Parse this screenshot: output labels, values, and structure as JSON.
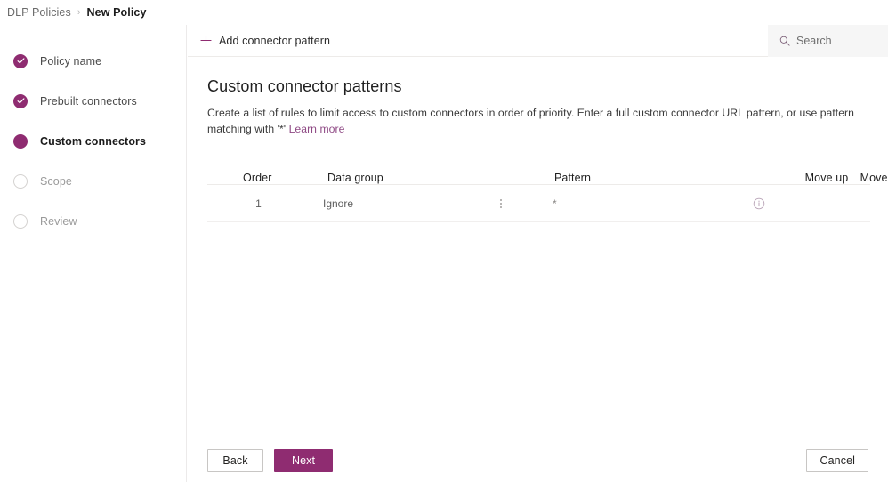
{
  "breadcrumb": {
    "parent": "DLP Policies",
    "separator": "›",
    "current": "New Policy"
  },
  "wizard": {
    "steps": [
      {
        "label": "Policy name",
        "state": "done",
        "icon": "check-icon"
      },
      {
        "label": "Prebuilt connectors",
        "state": "done",
        "icon": "check-icon"
      },
      {
        "label": "Custom connectors",
        "state": "active",
        "icon": "filled-circle-icon"
      },
      {
        "label": "Scope",
        "state": "todo",
        "icon": "empty-circle-icon"
      },
      {
        "label": "Review",
        "state": "todo",
        "icon": "empty-circle-icon"
      }
    ]
  },
  "commandbar": {
    "add_label": "Add connector pattern",
    "add_icon": "plus-icon"
  },
  "search": {
    "placeholder": "Search",
    "value": "",
    "icon": "search-icon"
  },
  "main": {
    "title": "Custom connector patterns",
    "description_part1": "Create a list of rules to limit access to custom connectors in order of priority. Enter a full custom connector URL pattern, or use pattern matching with '*' ",
    "link_label": "Learn more"
  },
  "table": {
    "headers": {
      "order": "Order",
      "data_group": "Data group",
      "pattern": "Pattern",
      "move_up": "Move up",
      "move_down": "Move down"
    },
    "rows": [
      {
        "order": "1",
        "data_group": "Ignore",
        "pattern": "*",
        "menu_icon": "kebab-menu-icon",
        "info_icon": "info-icon"
      }
    ]
  },
  "footer": {
    "back_label": "Back",
    "next_label": "Next",
    "cancel_label": "Cancel"
  },
  "colors": {
    "accent": "#8f2c71",
    "link": "#8f4a85",
    "border": "#edebe9",
    "search_bg": "#f6f6f6"
  }
}
